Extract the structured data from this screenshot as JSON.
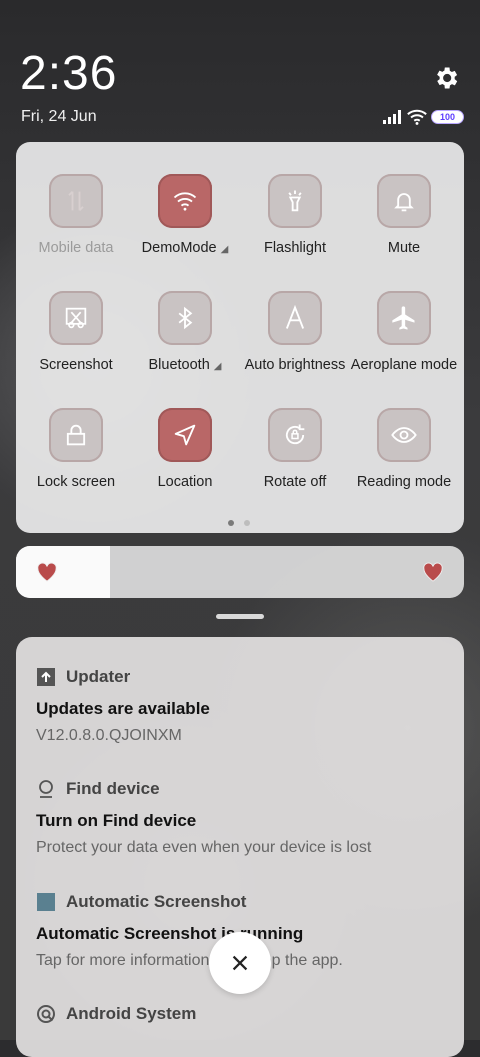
{
  "status": {
    "time": "2:36",
    "date": "Fri, 24 Jun",
    "battery": "100",
    "icons": [
      "settings-icon",
      "signal-icon",
      "wifi-icon",
      "battery-icon"
    ]
  },
  "tiles": [
    {
      "label": "Mobile data",
      "icon": "mobile-data-icon",
      "state": "disabled"
    },
    {
      "label": "DemoMode",
      "icon": "wifi-icon",
      "state": "on"
    },
    {
      "label": "Flashlight",
      "icon": "flashlight-icon",
      "state": "off"
    },
    {
      "label": "Mute",
      "icon": "bell-icon",
      "state": "off"
    },
    {
      "label": "Screenshot",
      "icon": "scissors-icon",
      "state": "off"
    },
    {
      "label": "Bluetooth",
      "icon": "bluetooth-icon",
      "state": "off"
    },
    {
      "label": "Auto brightness",
      "icon": "auto-brightness-icon",
      "state": "off"
    },
    {
      "label": "Aeroplane mode",
      "icon": "airplane-icon",
      "state": "off"
    },
    {
      "label": "Lock screen",
      "icon": "lock-icon",
      "state": "off"
    },
    {
      "label": "Location",
      "icon": "location-icon",
      "state": "on"
    },
    {
      "label": "Rotate off",
      "icon": "rotate-icon",
      "state": "off"
    },
    {
      "label": "Reading mode",
      "icon": "eye-icon",
      "state": "off"
    }
  ],
  "page_indicator": {
    "current": 1,
    "total": 2
  },
  "brightness": {
    "level": 0.21,
    "colors": {
      "heart": "#b94b4b"
    }
  },
  "notifications": [
    {
      "app": "Updater",
      "title": "Updates are available",
      "body": "V12.0.8.0.QJOINXM"
    },
    {
      "app": "Find device",
      "title": "Turn on Find device",
      "body": "Protect your data even when your device is lost"
    },
    {
      "app": "Automatic Screenshot",
      "title": "Automatic Screenshot is running",
      "body": "Tap for more information or to stop the app."
    },
    {
      "app": "Android System",
      "title": "",
      "body": ""
    }
  ],
  "colors": {
    "accent_on": "#b96767",
    "tile_off": "#c9c3c3",
    "battery": "#5d3dff"
  }
}
